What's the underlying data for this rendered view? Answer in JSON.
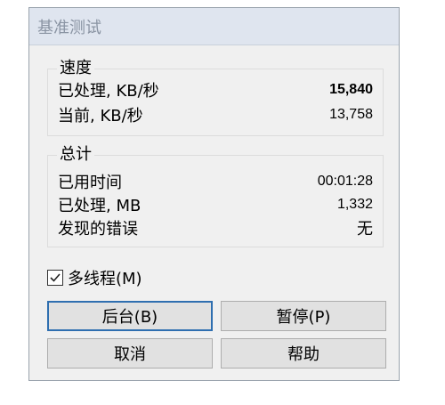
{
  "window": {
    "title": "基准测试"
  },
  "speed": {
    "title": "速度",
    "processed_label": "已处理, KB/秒",
    "processed_value": "15,840",
    "current_label": "当前, KB/秒",
    "current_value": "13,758"
  },
  "total": {
    "title": "总计",
    "elapsed_label": "已用时间",
    "elapsed_value": "00:01:28",
    "processed_label": "已处理, MB",
    "processed_value": "1,332",
    "errors_label": "发现的错误",
    "errors_value": "无"
  },
  "multithread": {
    "label": "多线程(M)",
    "checked": true
  },
  "buttons": {
    "background": "后台(B)",
    "pause": "暂停(P)",
    "cancel": "取消",
    "help": "帮助"
  },
  "colors": {
    "default_button_border": "#2f6fb0",
    "titlebar_text": "#8a94a3"
  }
}
